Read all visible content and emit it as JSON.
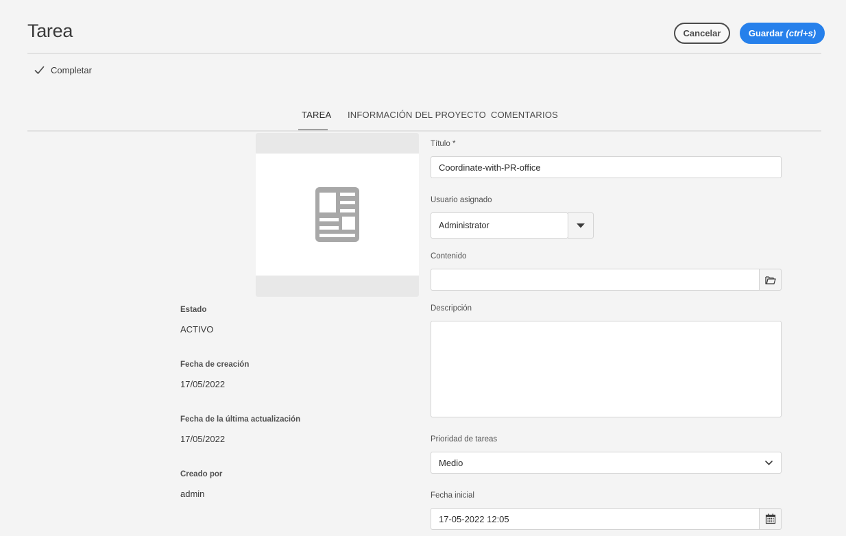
{
  "header": {
    "title": "Tarea",
    "cancel_label": "Cancelar",
    "save_label": "Guardar",
    "save_shortcut": "(ctrl+s)"
  },
  "actions": {
    "complete_label": "Completar"
  },
  "tabs": [
    {
      "label": "TAREA",
      "active": true
    },
    {
      "label": "INFORMACIÓN DEL PROYECTO",
      "active": false
    },
    {
      "label": "COMENTARIOS",
      "active": false
    }
  ],
  "thumbnail": {
    "icon": "document-icon"
  },
  "meta": {
    "status_label": "Estado",
    "status_value": "ACTIVO",
    "created_label": "Fecha de creación",
    "created_value": "17/05/2022",
    "updated_label": "Fecha de la última actualización",
    "updated_value": "17/05/2022",
    "created_by_label": "Creado por",
    "created_by_value": "admin"
  },
  "form": {
    "title_label": "Título *",
    "title_value": "Coordinate-with-PR-office",
    "assignee_label": "Usuario asignado",
    "assignee_value": "Administrator",
    "content_label": "Contenido",
    "content_value": "",
    "description_label": "Descripción",
    "description_value": "",
    "priority_label": "Prioridad de tareas",
    "priority_value": "Medio",
    "start_label": "Fecha inicial",
    "start_value": "17-05-2022 12:05"
  },
  "colors": {
    "accent": "#2680eb",
    "background": "#f4f4f4",
    "icon_gray": "#a8a8a8"
  }
}
